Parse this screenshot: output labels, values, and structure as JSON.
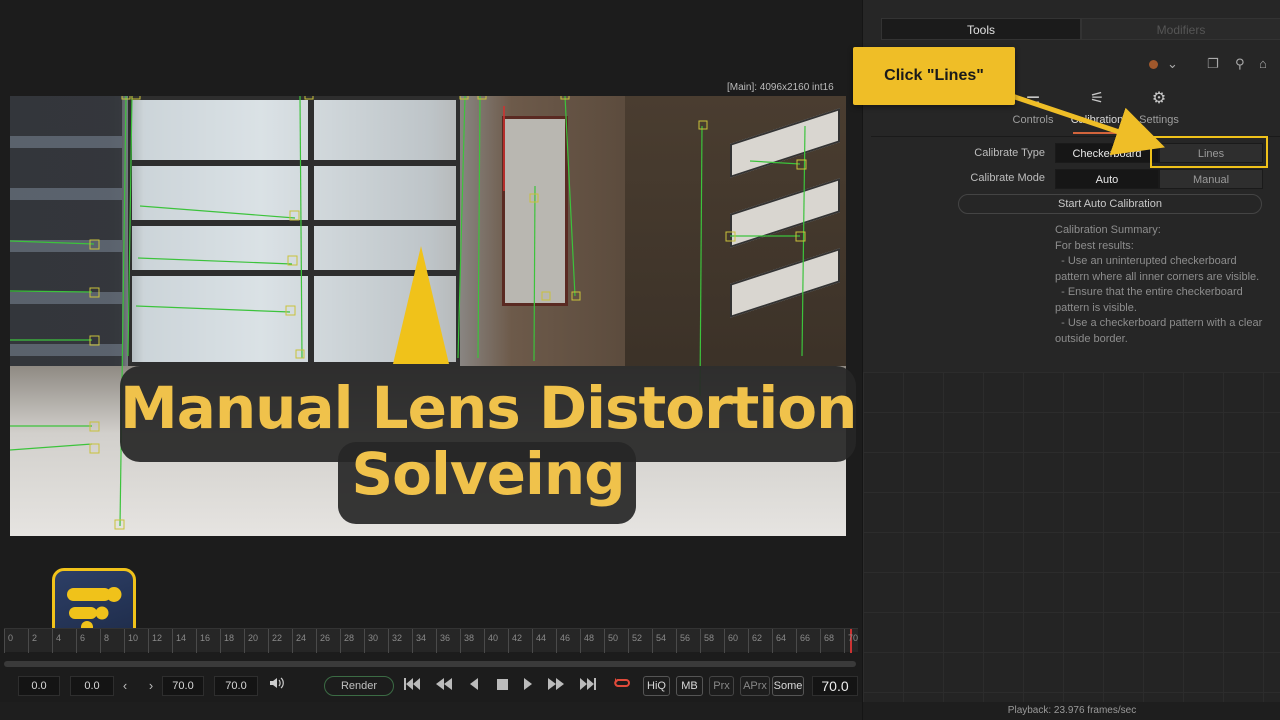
{
  "viewer": {
    "resolution_label": "[Main]: 4096x2160 int16",
    "headline_line1": "Manual Lens Distortion",
    "headline_line2": "Solveing"
  },
  "timeline": {
    "ruler_ticks": [
      "0",
      "2",
      "4",
      "6",
      "8",
      "10",
      "12",
      "14",
      "16",
      "18",
      "20",
      "22",
      "24",
      "26",
      "28",
      "30",
      "32",
      "34",
      "36",
      "38",
      "40",
      "42",
      "44",
      "46",
      "48",
      "50",
      "52",
      "54",
      "56",
      "58",
      "60",
      "62",
      "64",
      "66",
      "68",
      "70"
    ],
    "current_frame": "70.0"
  },
  "transport": {
    "start_time": "0.0",
    "global_start": "0.0",
    "end_time": "70.0",
    "global_end": "70.0",
    "render_label": "Render",
    "hiq_label": "HiQ",
    "mb_label": "MB",
    "prx_label": "Prx",
    "aprx_label": "APrx",
    "some_label": "Some",
    "frame_readout": "70.0",
    "icons": {
      "prev": "chevron-left-icon",
      "next": "chevron-right-icon",
      "audio": "speaker-icon",
      "first": "skip-to-start-icon",
      "rewind": "rewind-icon",
      "play_reverse": "play-reverse-icon",
      "stop": "stop-icon",
      "play": "play-icon",
      "ffwd": "fast-forward-icon",
      "last": "skip-to-end-icon",
      "loop": "loop-icon"
    }
  },
  "inspector": {
    "tabs": [
      "Tools",
      "Modifiers"
    ],
    "subtabs": [
      {
        "label": "Controls",
        "icon": "sliders-icon"
      },
      {
        "label": "Calibration",
        "icon": "calibration-icon"
      },
      {
        "label": "Settings",
        "icon": "settings-icon"
      }
    ],
    "active_subtab": "Calibration",
    "calibrate_type_label": "Calibrate Type",
    "calibrate_type_options": [
      "Checkerboard",
      "Lines"
    ],
    "calibrate_type_selected": "Checkerboard",
    "calibrate_mode_label": "Calibrate Mode",
    "calibrate_mode_options": [
      "Auto",
      "Manual"
    ],
    "calibrate_mode_selected": "Auto",
    "start_button": "Start Auto Calibration",
    "summary": [
      "Calibration Summary:",
      "For best results:",
      "  - Use an uninterupted checkerboard pattern where all inner corners are visible.",
      "  - Ensure that the entire checkerboard pattern is visible.",
      "  - Use a checkerboard pattern with a clear outside border."
    ],
    "status": "Playback: 23.976 frames/sec"
  },
  "callout": {
    "text": "Click \"Lines\"",
    "color": "#efbe27"
  },
  "colors": {
    "accent": "#f0c24b",
    "highlight": "#f0c21a",
    "active_tab_underline": "#d2643c",
    "track_green": "#3cc33c",
    "track_red": "#d23030"
  }
}
